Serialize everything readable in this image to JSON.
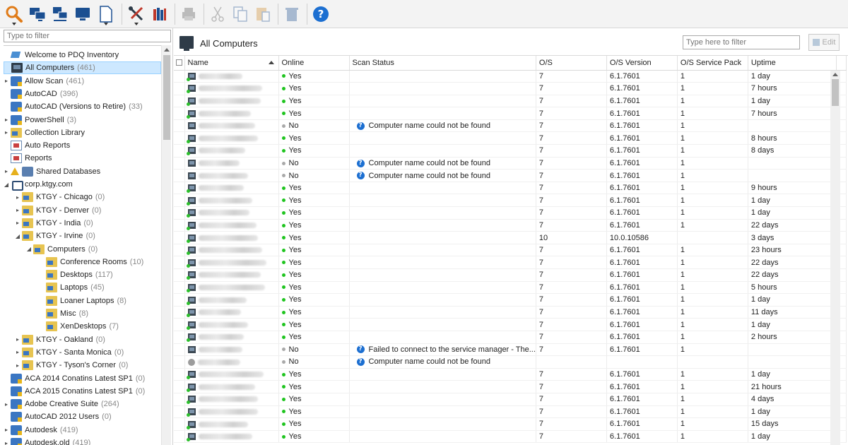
{
  "toolbar": {
    "buttons": [
      {
        "name": "scan-icon",
        "color": "#e07b18"
      },
      {
        "name": "scan-computers-icon",
        "color": "#1b4f91"
      },
      {
        "name": "network-scan-icon",
        "color": "#1b4f91"
      },
      {
        "name": "add-computer-icon",
        "color": "#1b4f91"
      },
      {
        "name": "new-document-icon",
        "color": "#1b4f91"
      },
      {
        "name": "tools-icon",
        "color": "#c0392b"
      },
      {
        "name": "library-icon",
        "color": "#1b4f91"
      },
      {
        "name": "print-icon",
        "color": "#555"
      },
      {
        "name": "cut-icon",
        "color": "#555"
      },
      {
        "name": "copy-icon",
        "color": "#555"
      },
      {
        "name": "paste-icon",
        "color": "#555"
      },
      {
        "name": "delete-icon",
        "color": "#555"
      },
      {
        "name": "help-icon",
        "color": "#1c6fd1"
      }
    ]
  },
  "left": {
    "filter_placeholder": "Type to filter",
    "tree": [
      {
        "label": "Welcome to PDQ Inventory",
        "count": "",
        "icon": "welcome",
        "indent": 1,
        "exp": ""
      },
      {
        "label": "All Computers",
        "count": "(461)",
        "icon": "monitor",
        "indent": 1,
        "exp": "",
        "selected": true
      },
      {
        "label": "Allow Scan",
        "count": "(461)",
        "icon": "coll",
        "indent": 1,
        "exp": "▸"
      },
      {
        "label": "AutoCAD",
        "count": "(396)",
        "icon": "coll",
        "indent": 1,
        "exp": ""
      },
      {
        "label": "AutoCAD (Versions to Retire)",
        "count": "(33)",
        "icon": "coll",
        "indent": 1,
        "exp": ""
      },
      {
        "label": "PowerShell",
        "count": "(3)",
        "icon": "coll",
        "indent": 1,
        "exp": "▸"
      },
      {
        "label": "Collection Library",
        "count": "",
        "icon": "folder",
        "indent": 1,
        "exp": "▸"
      },
      {
        "label": "Auto Reports",
        "count": "",
        "icon": "report",
        "indent": 1,
        "exp": ""
      },
      {
        "label": "Reports",
        "count": "",
        "icon": "report",
        "indent": 1,
        "exp": ""
      },
      {
        "label": "Shared Databases",
        "count": "",
        "icon": "db",
        "indent": 1,
        "exp": "▸",
        "warn": true
      },
      {
        "label": "corp.ktgy.com",
        "count": "",
        "icon": "domain",
        "indent": 1,
        "exp": "◢"
      },
      {
        "label": "KTGY - Chicago",
        "count": "(0)",
        "icon": "folder",
        "indent": 2,
        "exp": "▸"
      },
      {
        "label": "KTGY - Denver",
        "count": "(0)",
        "icon": "folder",
        "indent": 2,
        "exp": "▸"
      },
      {
        "label": "KTGY - India",
        "count": "(0)",
        "icon": "folder",
        "indent": 2,
        "exp": "▸"
      },
      {
        "label": "KTGY - Irvine",
        "count": "(0)",
        "icon": "folder",
        "indent": 2,
        "exp": "◢"
      },
      {
        "label": "Computers",
        "count": "(0)",
        "icon": "folder",
        "indent": 3,
        "exp": "◢"
      },
      {
        "label": "Conference Rooms",
        "count": "(10)",
        "icon": "folder",
        "indent": 4,
        "exp": ""
      },
      {
        "label": "Desktops",
        "count": "(117)",
        "icon": "folder",
        "indent": 4,
        "exp": ""
      },
      {
        "label": "Laptops",
        "count": "(45)",
        "icon": "folder",
        "indent": 4,
        "exp": ""
      },
      {
        "label": "Loaner Laptops",
        "count": "(8)",
        "icon": "folder",
        "indent": 4,
        "exp": ""
      },
      {
        "label": "Misc",
        "count": "(8)",
        "icon": "folder",
        "indent": 4,
        "exp": ""
      },
      {
        "label": "XenDesktops",
        "count": "(7)",
        "icon": "folder",
        "indent": 4,
        "exp": ""
      },
      {
        "label": "KTGY - Oakland",
        "count": "(0)",
        "icon": "folder",
        "indent": 2,
        "exp": "▸"
      },
      {
        "label": "KTGY - Santa Monica",
        "count": "(0)",
        "icon": "folder",
        "indent": 2,
        "exp": "▸"
      },
      {
        "label": "KTGY - Tyson's Corner",
        "count": "(0)",
        "icon": "folder",
        "indent": 2,
        "exp": "▸"
      },
      {
        "label": "ACA 2014 Conatins Latest SP1",
        "count": "(0)",
        "icon": "coll",
        "indent": 1,
        "exp": ""
      },
      {
        "label": "ACA 2015 Conatins Latest SP1",
        "count": "(0)",
        "icon": "coll",
        "indent": 1,
        "exp": ""
      },
      {
        "label": "Adobe Creative Suite",
        "count": "(264)",
        "icon": "coll",
        "indent": 1,
        "exp": "▸"
      },
      {
        "label": "AutoCAD 2012 Users",
        "count": "(0)",
        "icon": "coll",
        "indent": 1,
        "exp": ""
      },
      {
        "label": "Autodesk",
        "count": "(419)",
        "icon": "coll",
        "indent": 1,
        "exp": "▸"
      },
      {
        "label": "Autodesk.old",
        "count": "(419)",
        "icon": "coll",
        "indent": 1,
        "exp": "▸"
      }
    ]
  },
  "main": {
    "title": "All Computers",
    "filter_placeholder": "Type here to filter",
    "edit_label": "Edit",
    "columns": [
      "Name",
      "Online",
      "Scan Status",
      "O/S",
      "O/S Version",
      "O/S Service Pack",
      "Uptime"
    ],
    "rows": [
      {
        "online": "Yes",
        "scan": "",
        "os": "7",
        "osv": "6.1.7601",
        "sp": "1",
        "up": "1 day",
        "w": 62
      },
      {
        "online": "Yes",
        "scan": "",
        "os": "7",
        "osv": "6.1.7601",
        "sp": "1",
        "up": "7 hours",
        "w": 90
      },
      {
        "online": "Yes",
        "scan": "",
        "os": "7",
        "osv": "6.1.7601",
        "sp": "1",
        "up": "1 day",
        "w": 88
      },
      {
        "online": "Yes",
        "scan": "",
        "os": "7",
        "osv": "6.1.7601",
        "sp": "1",
        "up": "7 hours",
        "w": 74
      },
      {
        "online": "No",
        "scan": "Computer name could not be found",
        "os": "7",
        "osv": "6.1.7601",
        "sp": "1",
        "up": "",
        "w": 80
      },
      {
        "online": "Yes",
        "scan": "",
        "os": "7",
        "osv": "6.1.7601",
        "sp": "1",
        "up": "8 hours",
        "w": 84
      },
      {
        "online": "Yes",
        "scan": "",
        "os": "7",
        "osv": "6.1.7601",
        "sp": "1",
        "up": "8 days",
        "w": 66
      },
      {
        "online": "No",
        "scan": "Computer name could not be found",
        "os": "7",
        "osv": "6.1.7601",
        "sp": "1",
        "up": "",
        "w": 58
      },
      {
        "online": "No",
        "scan": "Computer name could not be found",
        "os": "7",
        "osv": "6.1.7601",
        "sp": "1",
        "up": "",
        "w": 70
      },
      {
        "online": "Yes",
        "scan": "",
        "os": "7",
        "osv": "6.1.7601",
        "sp": "1",
        "up": "9 hours",
        "w": 64
      },
      {
        "online": "Yes",
        "scan": "",
        "os": "7",
        "osv": "6.1.7601",
        "sp": "1",
        "up": "1 day",
        "w": 76
      },
      {
        "online": "Yes",
        "scan": "",
        "os": "7",
        "osv": "6.1.7601",
        "sp": "1",
        "up": "1 day",
        "w": 72
      },
      {
        "online": "Yes",
        "scan": "",
        "os": "7",
        "osv": "6.1.7601",
        "sp": "1",
        "up": "22 days",
        "w": 82
      },
      {
        "online": "Yes",
        "scan": "",
        "os": "10",
        "osv": "10.0.10586",
        "sp": "",
        "up": "3 days",
        "w": 84
      },
      {
        "online": "Yes",
        "scan": "",
        "os": "7",
        "osv": "6.1.7601",
        "sp": "1",
        "up": "23 hours",
        "w": 90
      },
      {
        "online": "Yes",
        "scan": "",
        "os": "7",
        "osv": "6.1.7601",
        "sp": "1",
        "up": "22 days",
        "w": 96
      },
      {
        "online": "Yes",
        "scan": "",
        "os": "7",
        "osv": "6.1.7601",
        "sp": "1",
        "up": "22 days",
        "w": 88
      },
      {
        "online": "Yes",
        "scan": "",
        "os": "7",
        "osv": "6.1.7601",
        "sp": "1",
        "up": "5 hours",
        "w": 94
      },
      {
        "online": "Yes",
        "scan": "",
        "os": "7",
        "osv": "6.1.7601",
        "sp": "1",
        "up": "1 day",
        "w": 68
      },
      {
        "online": "Yes",
        "scan": "",
        "os": "7",
        "osv": "6.1.7601",
        "sp": "1",
        "up": "11 days",
        "w": 60
      },
      {
        "online": "Yes",
        "scan": "",
        "os": "7",
        "osv": "6.1.7601",
        "sp": "1",
        "up": "1 day",
        "w": 70
      },
      {
        "online": "Yes",
        "scan": "",
        "os": "7",
        "osv": "6.1.7601",
        "sp": "1",
        "up": "2 hours",
        "w": 64
      },
      {
        "online": "No",
        "scan": "Failed to connect to the service manager - The...",
        "os": "7",
        "osv": "6.1.7601",
        "sp": "1",
        "up": "",
        "w": 62
      },
      {
        "online": "No",
        "scan": "Computer name could not be found",
        "os": "",
        "osv": "",
        "sp": "",
        "up": "",
        "w": 60,
        "unknown": true
      },
      {
        "online": "Yes",
        "scan": "",
        "os": "7",
        "osv": "6.1.7601",
        "sp": "1",
        "up": "1 day",
        "w": 92
      },
      {
        "online": "Yes",
        "scan": "",
        "os": "7",
        "osv": "6.1.7601",
        "sp": "1",
        "up": "21 hours",
        "w": 80
      },
      {
        "online": "Yes",
        "scan": "",
        "os": "7",
        "osv": "6.1.7601",
        "sp": "1",
        "up": "4 days",
        "w": 84
      },
      {
        "online": "Yes",
        "scan": "",
        "os": "7",
        "osv": "6.1.7601",
        "sp": "1",
        "up": "1 day",
        "w": 84
      },
      {
        "online": "Yes",
        "scan": "",
        "os": "7",
        "osv": "6.1.7601",
        "sp": "1",
        "up": "15 days",
        "w": 70
      },
      {
        "online": "Yes",
        "scan": "",
        "os": "7",
        "osv": "6.1.7601",
        "sp": "1",
        "up": "1 day",
        "w": 76
      }
    ]
  }
}
